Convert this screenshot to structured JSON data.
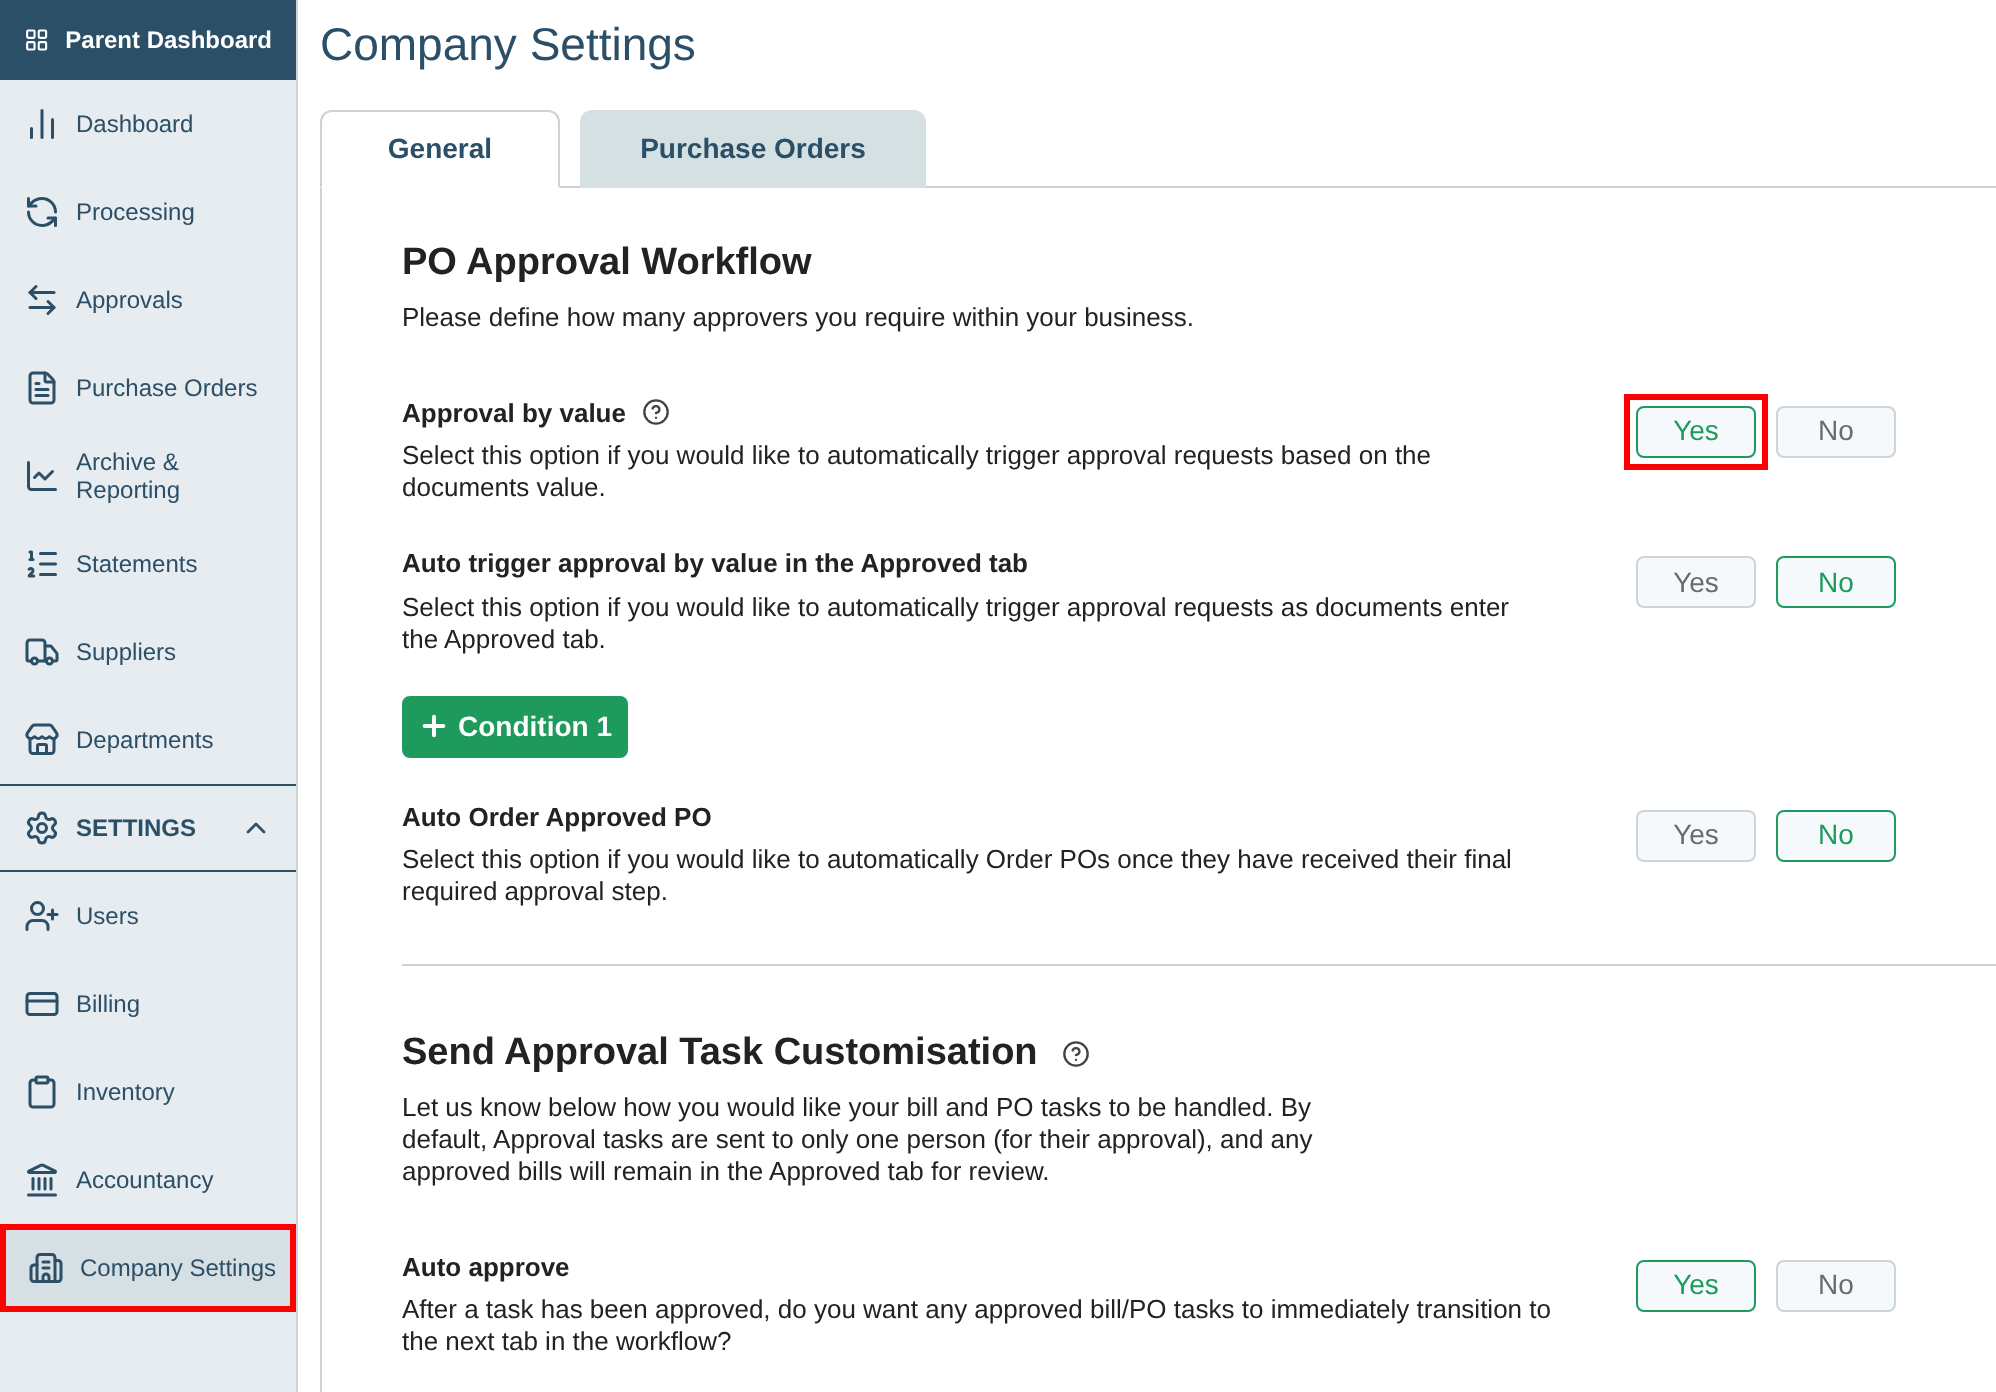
{
  "sidebar": {
    "header": "Parent Dashboard",
    "items": [
      {
        "label": "Dashboard",
        "selected": false
      },
      {
        "label": "Processing",
        "selected": false
      },
      {
        "label": "Approvals",
        "selected": false
      },
      {
        "label": "Purchase Orders",
        "selected": false
      },
      {
        "label": "Archive & Reporting",
        "selected": false
      },
      {
        "label": "Statements",
        "selected": false
      },
      {
        "label": "Suppliers",
        "selected": false
      },
      {
        "label": "Departments",
        "selected": false
      }
    ],
    "settings": {
      "label": "SETTINGS",
      "expanded": true,
      "children": [
        {
          "label": "Users",
          "selected": false
        },
        {
          "label": "Billing",
          "selected": false
        },
        {
          "label": "Inventory",
          "selected": false
        },
        {
          "label": "Accountancy",
          "selected": false
        },
        {
          "label": "Company Settings",
          "selected": true,
          "highlighted": true
        }
      ]
    }
  },
  "page_title": "Company Settings",
  "tabs": [
    {
      "label": "General",
      "selected": true
    },
    {
      "label": "Purchase Orders",
      "selected": false
    }
  ],
  "sections": [
    {
      "title": "PO Approval Workflow",
      "help": false,
      "description": "Please define how many approvers you require within your business.",
      "items": [
        {
          "kind": "toggle",
          "title": "Approval by value",
          "help": true,
          "description": "Select this option if you would like to automatically trigger approval requests based on the documents value.",
          "options": [
            {
              "label": "Yes",
              "selected": true,
              "highlighted": true
            },
            {
              "label": "No",
              "selected": false,
              "highlighted": false
            }
          ]
        },
        {
          "kind": "toggle",
          "title": "Auto trigger approval by value in the Approved tab",
          "help": false,
          "description": "Select this option if you would like to automatically trigger approval requests as documents enter the Approved tab.",
          "options": [
            {
              "label": "Yes",
              "selected": false,
              "highlighted": false
            },
            {
              "label": "No",
              "selected": true,
              "highlighted": false
            }
          ]
        },
        {
          "kind": "button",
          "label": "Condition 1"
        },
        {
          "kind": "toggle",
          "title": "Auto Order Approved PO",
          "help": false,
          "description": "Select this option if you would like to automatically Order POs once they have received their final required approval step.",
          "options": [
            {
              "label": "Yes",
              "selected": false,
              "highlighted": false
            },
            {
              "label": "No",
              "selected": true,
              "highlighted": false
            }
          ]
        }
      ]
    },
    {
      "title": "Send Approval Task Customisation",
      "help": true,
      "description": "Let us know below how you would like your bill and PO tasks to be handled. By default, Approval tasks are sent to only one person (for their approval), and any approved bills will remain in the Approved tab for review.",
      "items": [
        {
          "kind": "toggle",
          "title": "Auto approve",
          "help": false,
          "description": "After a task has been approved, do you want any approved bill/PO tasks to immediately transition to the next tab in the workflow?",
          "options": [
            {
              "label": "Yes",
              "selected": true,
              "highlighted": false
            },
            {
              "label": "No",
              "selected": false,
              "highlighted": false
            }
          ]
        }
      ]
    }
  ]
}
